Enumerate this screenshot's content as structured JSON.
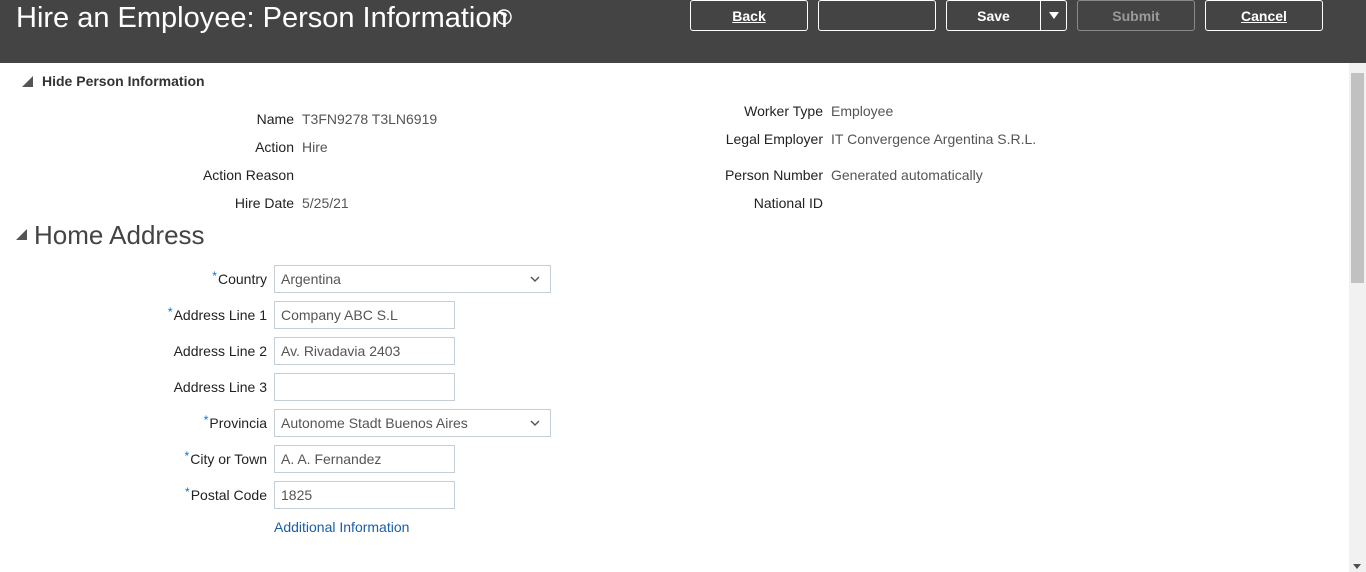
{
  "header": {
    "title": "Hire an Employee: Person Information",
    "buttons": {
      "back_label": "Back",
      "blank_label": "",
      "save_label": "Save",
      "submit_label": "Submit",
      "cancel_label": "Cancel"
    }
  },
  "person_section": {
    "toggle_label": "Hide Person Information",
    "left": [
      {
        "label": "Name",
        "value": "T3FN9278 T3LN6919"
      },
      {
        "label": "Action",
        "value": "Hire"
      },
      {
        "label": "Action Reason",
        "value": ""
      },
      {
        "label": "Hire Date",
        "value": "5/25/21"
      }
    ],
    "right": [
      {
        "label": "Worker Type",
        "value": "Employee"
      },
      {
        "label": "Legal Employer",
        "value": "IT Convergence Argentina S.R.L."
      },
      {
        "label": "Person Number",
        "value": "Generated automatically"
      },
      {
        "label": "National ID",
        "value": ""
      }
    ]
  },
  "home_address": {
    "title": "Home Address",
    "fields": {
      "country": {
        "label": "Country",
        "value": "Argentina",
        "required": "*"
      },
      "address1": {
        "label": "Address Line 1",
        "value": "Company ABC S.L",
        "required": "*"
      },
      "address2": {
        "label": "Address Line 2",
        "value": "Av. Rivadavia 2403"
      },
      "address3": {
        "label": "Address Line 3",
        "value": ""
      },
      "provincia": {
        "label": "Provincia",
        "value": "Autonome Stadt Buenos Aires",
        "required": "*"
      },
      "city": {
        "label": "City or Town",
        "value": "A. A. Fernandez",
        "required": "*"
      },
      "postal": {
        "label": "Postal Code",
        "value": "1825",
        "required": "*"
      }
    },
    "additional_link": "Additional Information"
  },
  "colors": {
    "header_bg": "#444444",
    "required_marker": "#0572ce",
    "link": "#1a5ea8"
  }
}
